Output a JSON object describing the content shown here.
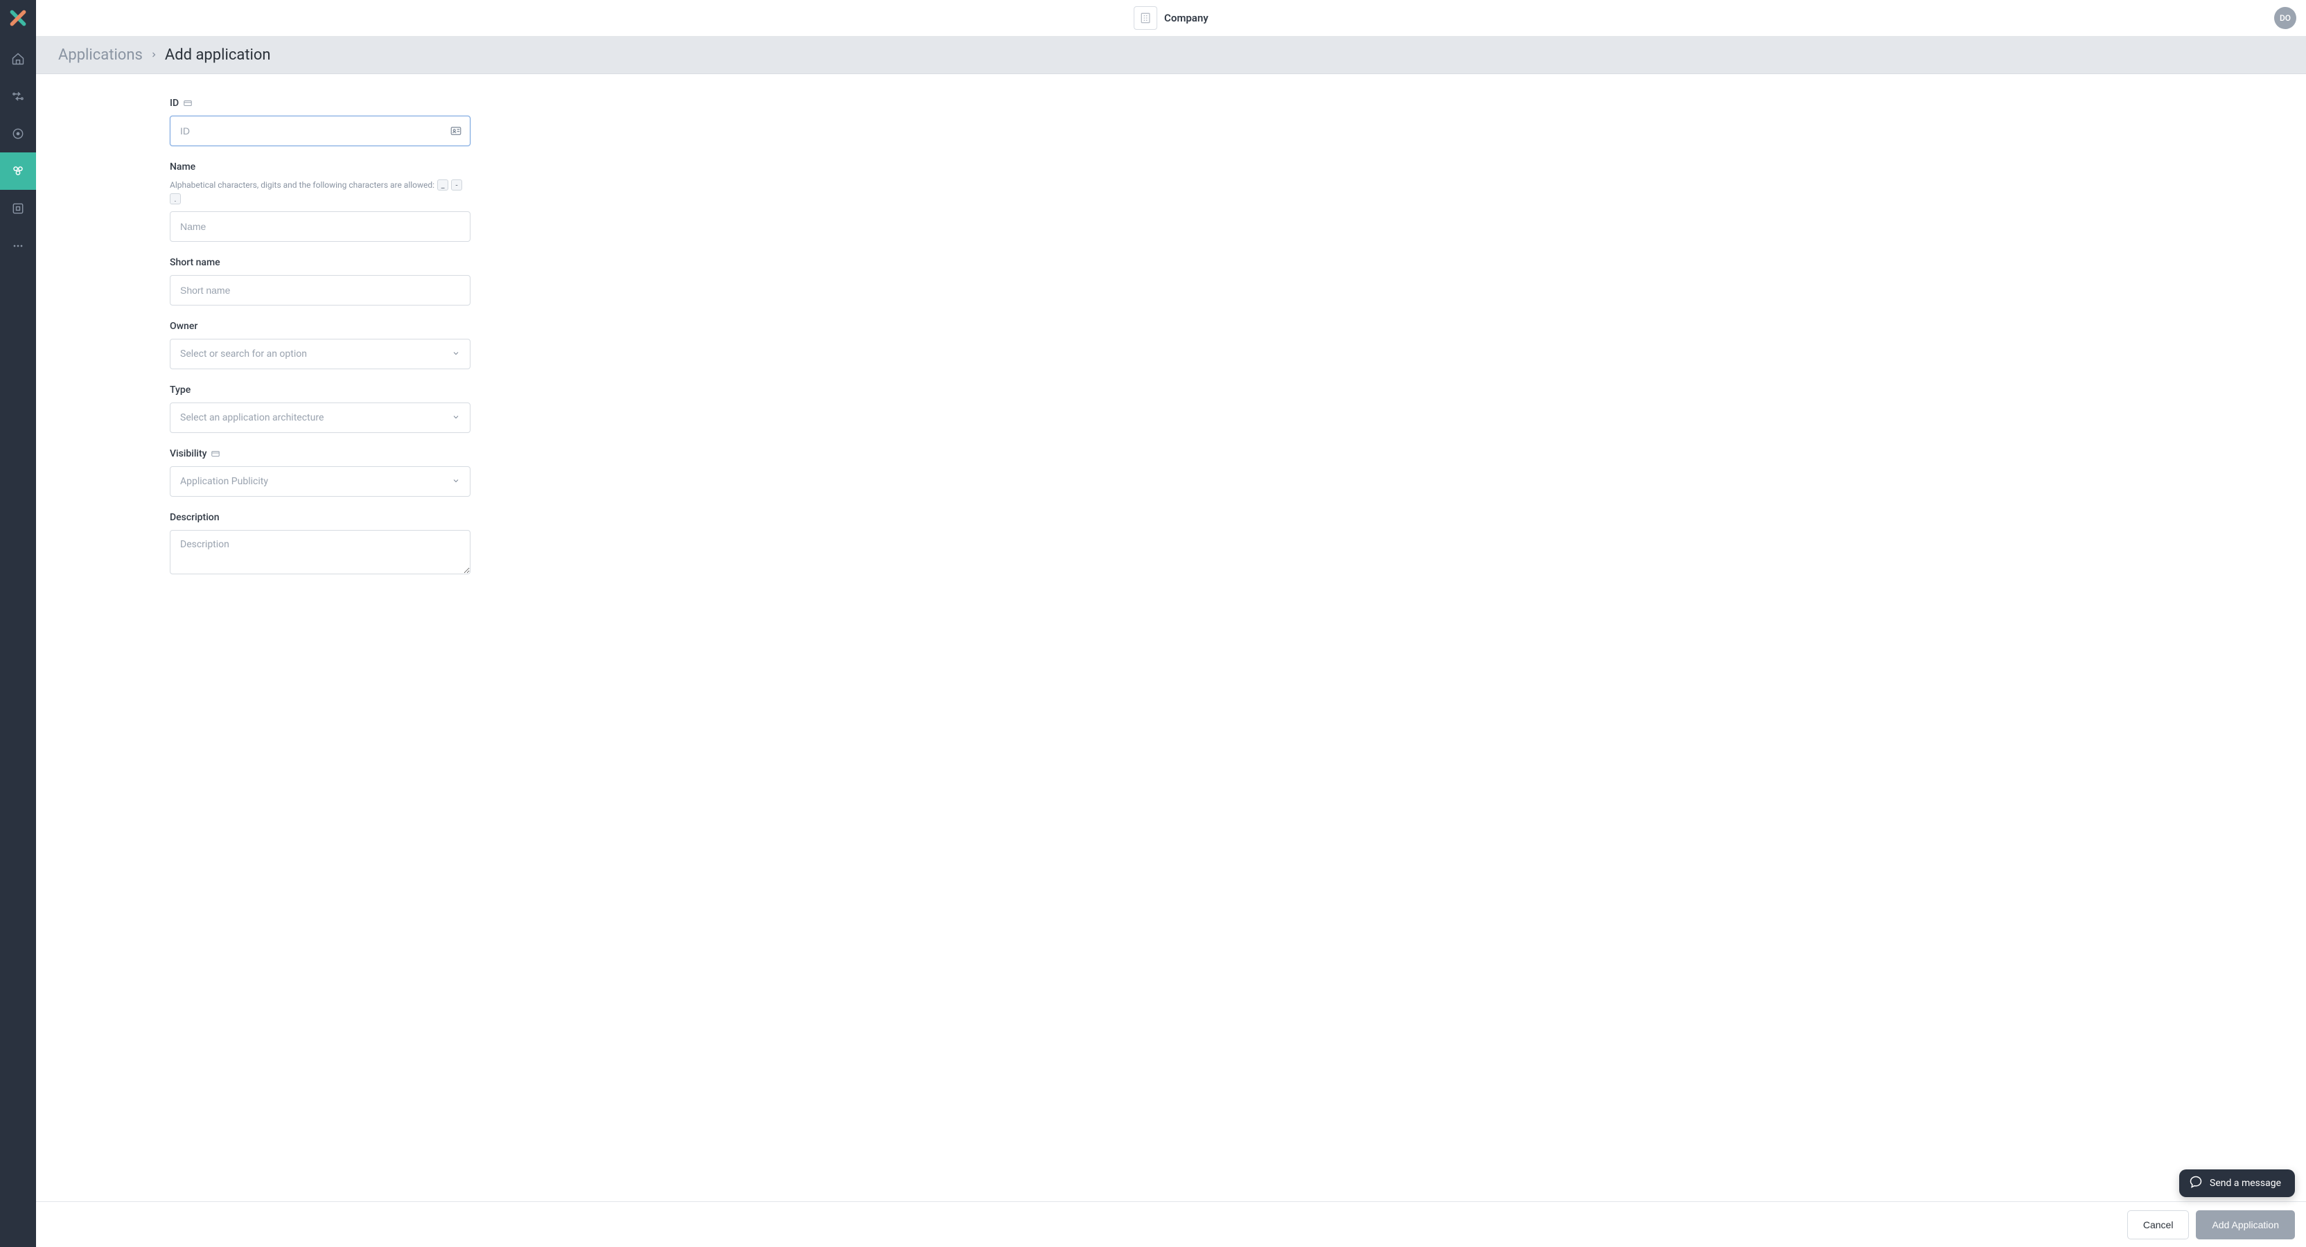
{
  "header": {
    "company_label": "Company",
    "avatar_initials": "DO"
  },
  "breadcrumb": {
    "root": "Applications",
    "current": "Add application"
  },
  "form": {
    "id": {
      "label": "ID",
      "placeholder": "ID"
    },
    "name": {
      "label": "Name",
      "help_text": "Alphabetical characters, digits and the following characters are allowed:",
      "chips": [
        "_",
        "-",
        "."
      ],
      "placeholder": "Name"
    },
    "short_name": {
      "label": "Short name",
      "placeholder": "Short name"
    },
    "owner": {
      "label": "Owner",
      "placeholder": "Select or search for an option"
    },
    "type": {
      "label": "Type",
      "placeholder": "Select an application architecture"
    },
    "visibility": {
      "label": "Visibility",
      "placeholder": "Application Publicity"
    },
    "description": {
      "label": "Description",
      "placeholder": "Description"
    }
  },
  "footer": {
    "cancel": "Cancel",
    "submit": "Add Application"
  },
  "chat": {
    "label": "Send a message"
  }
}
